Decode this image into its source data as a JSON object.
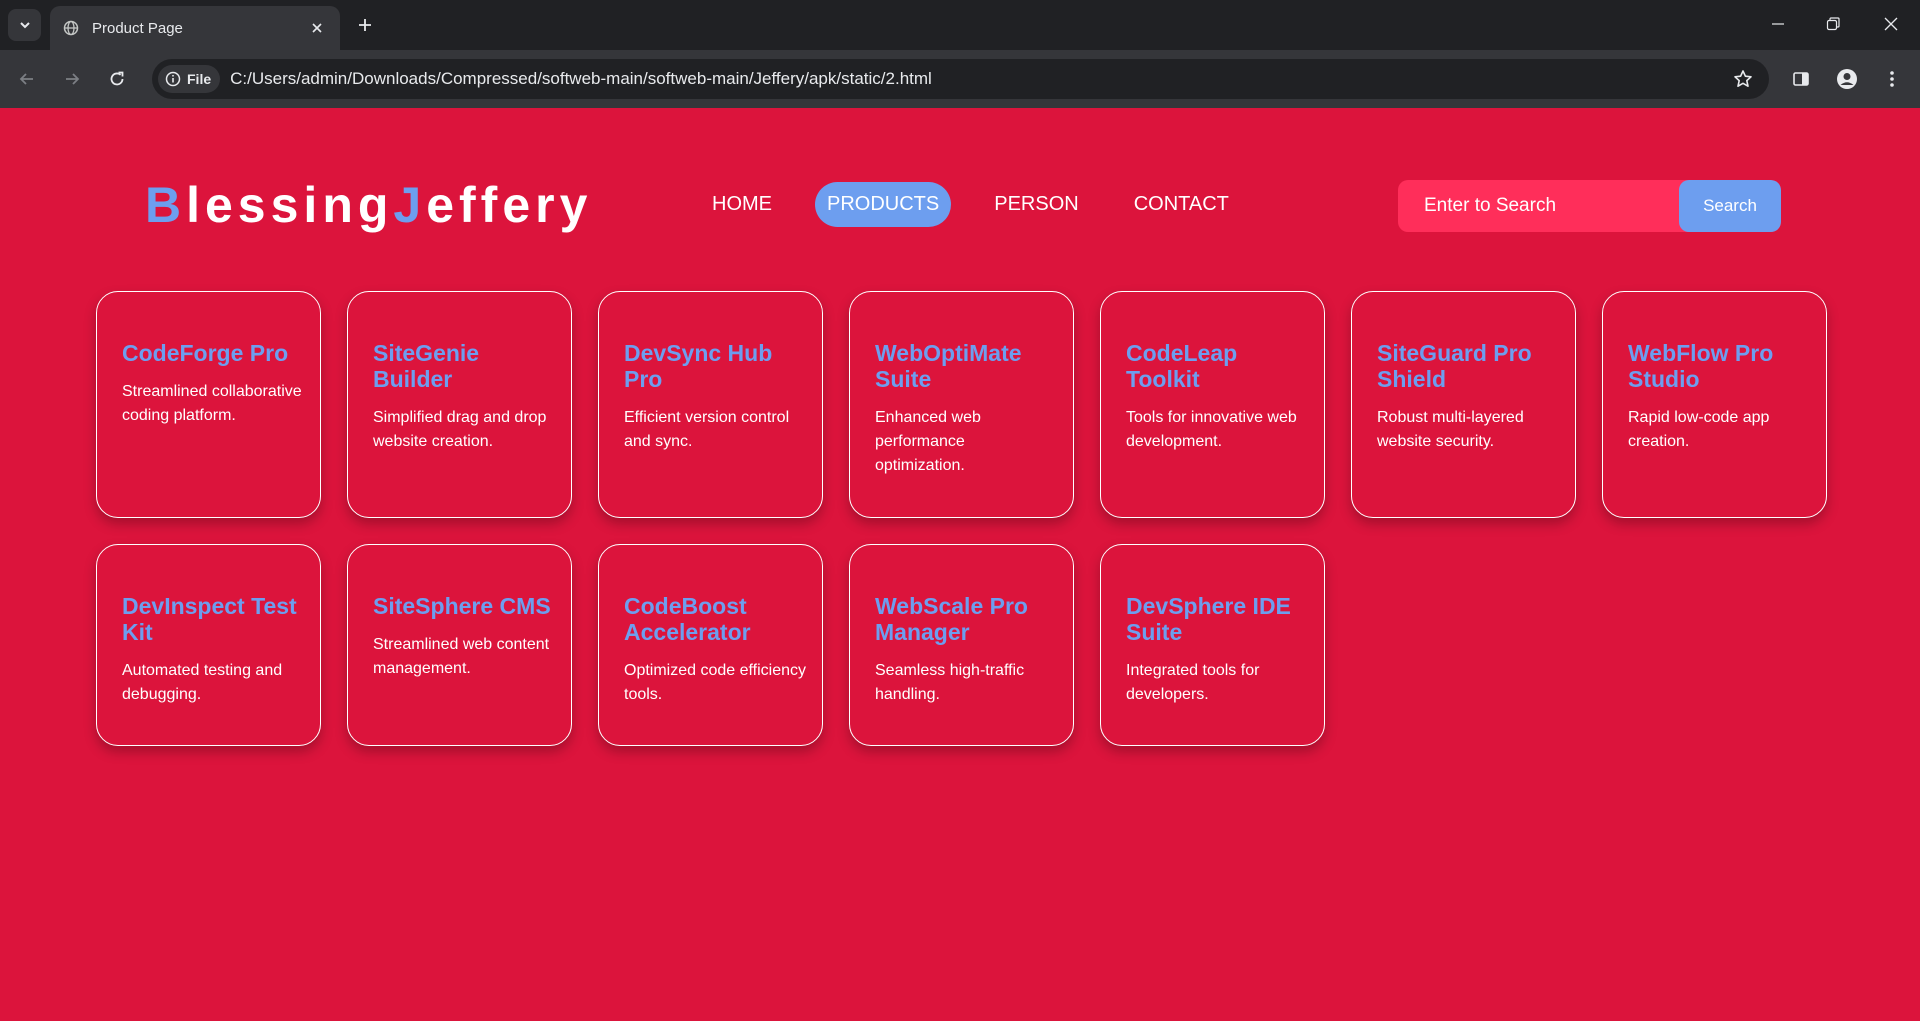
{
  "browser": {
    "tab_title": "Product Page",
    "file_chip": "File",
    "url": "C:/Users/admin/Downloads/Compressed/softweb-main/softweb-main/Jeffery/apk/static/2.html"
  },
  "logo": {
    "first_initial": "B",
    "first_rest": "lessing",
    "last_initial": "J",
    "last_rest": "effery"
  },
  "nav": {
    "home": "HOME",
    "products": "PRODUCTS",
    "person": "PERSON",
    "contact": "CONTACT"
  },
  "search": {
    "placeholder": "Enter to Search",
    "button": "Search"
  },
  "products": [
    {
      "title": "CodeForge Pro",
      "desc": "Streamlined collaborative coding platform."
    },
    {
      "title": "SiteGenie Builder",
      "desc": "Simplified drag and drop website creation."
    },
    {
      "title": "DevSync Hub Pro",
      "desc": "Efficient version control and sync."
    },
    {
      "title": "WebOptiMate Suite",
      "desc": "Enhanced web performance optimization."
    },
    {
      "title": "CodeLeap Toolkit",
      "desc": "Tools for innovative web development."
    },
    {
      "title": "SiteGuard Pro Shield",
      "desc": "Robust multi-layered website security."
    },
    {
      "title": "WebFlow Pro Studio",
      "desc": "Rapid low-code app creation."
    },
    {
      "title": "DevInspect Test Kit",
      "desc": "Automated testing and debugging."
    },
    {
      "title": "SiteSphere CMS",
      "desc": "Streamlined web content management."
    },
    {
      "title": "CodeBoost Accelerator",
      "desc": "Optimized code efficiency tools."
    },
    {
      "title": "WebScale Pro Manager",
      "desc": "Seamless high-traffic handling."
    },
    {
      "title": "DevSphere IDE Suite",
      "desc": "Integrated tools for developers."
    }
  ],
  "colors": {
    "background": "#dc143c",
    "accent": "#6d9eef",
    "search_bg": "#ff2e5a"
  }
}
